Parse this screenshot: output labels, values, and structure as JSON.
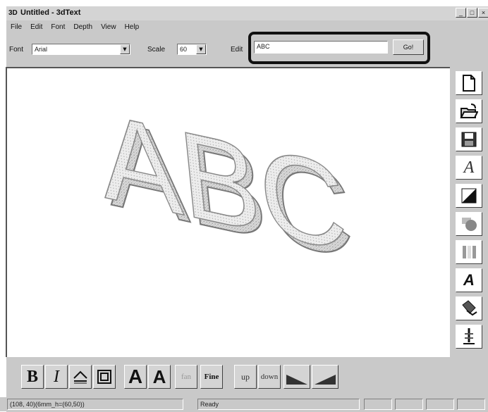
{
  "window": {
    "title": "Untitled - 3dText",
    "icon_text": "3D"
  },
  "titlebar_buttons": {
    "minimize": "_",
    "maximize": "□",
    "close": "×"
  },
  "menu": [
    "File",
    "Edit",
    "Font",
    "Depth",
    "View",
    "Help"
  ],
  "toolbar": {
    "font_label": "Font",
    "font_value": "Arial",
    "scale_label": "Scale",
    "scale_value": "60",
    "edit_label": "Edit",
    "edit_value": "ABC",
    "go_label": "Go!"
  },
  "canvas": {
    "text": "ABC"
  },
  "right_toolbar": [
    "new-document-icon",
    "open-folder-icon",
    "save-disk-icon",
    "font-a-icon",
    "fill-diagonal-icon",
    "shape-icon",
    "columns-icon",
    "text-style-a-icon",
    "bucket-icon",
    "calligraphy-icon"
  ],
  "bottom_toolbar": {
    "bold": "B",
    "italic": "I",
    "font_a1": "A",
    "font_a2": "A",
    "fan": "fan",
    "fine": "Fine",
    "up": "up",
    "down": "down"
  },
  "status": {
    "coords": "(108, 40)(6mm_h=(60,50))",
    "message": "Ready"
  }
}
